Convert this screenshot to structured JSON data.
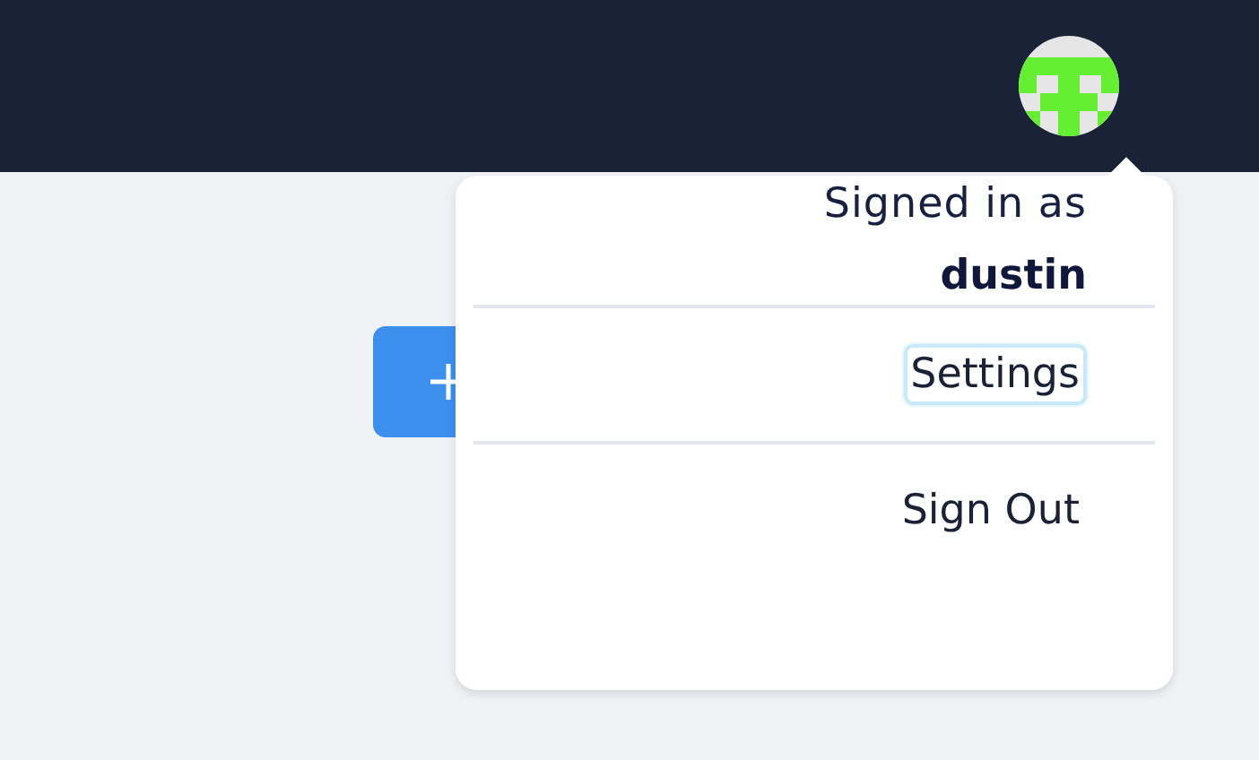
{
  "menu": {
    "signed_in_label": "Signed in as",
    "username": "dustin",
    "items": [
      {
        "label": "Settings",
        "focused": true
      },
      {
        "label": "Sign Out",
        "focused": false
      }
    ]
  }
}
